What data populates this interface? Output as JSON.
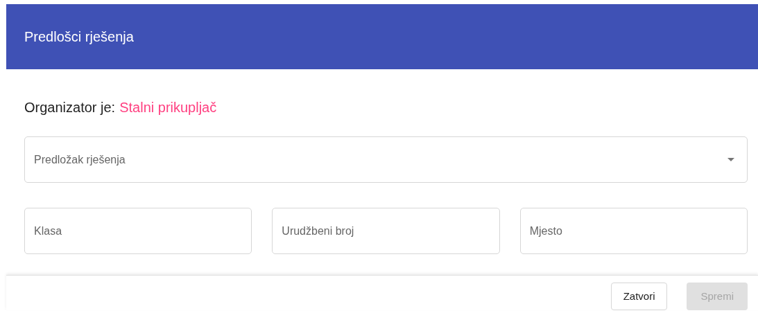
{
  "dialog": {
    "title": "Predlošci rješenja"
  },
  "organizer": {
    "label": "Organizator je:",
    "value": "Stalni prikupljač"
  },
  "template_select": {
    "placeholder": "Predložak rješenja"
  },
  "fields": [
    {
      "placeholder": "Klasa"
    },
    {
      "placeholder": "Urudžbeni broj"
    },
    {
      "placeholder": "Mjesto"
    }
  ],
  "buttons": [
    {
      "label": "Zatvori",
      "disabled": false
    },
    {
      "label": "Spremi",
      "disabled": true
    }
  ]
}
